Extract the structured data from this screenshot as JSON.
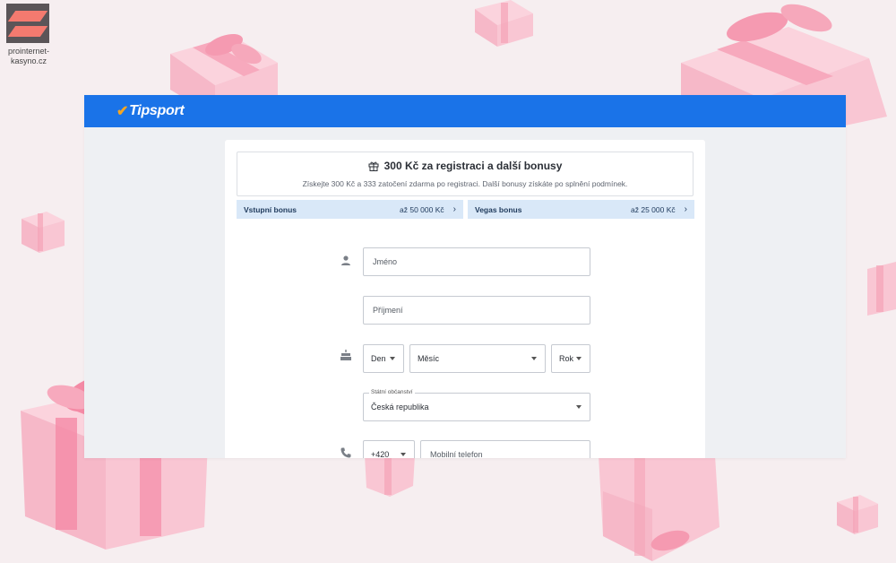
{
  "watermark": {
    "line1": "prointernet-",
    "line2": "kasyno.cz"
  },
  "header": {
    "brand": "Tipsport"
  },
  "promo": {
    "title": "300 Kč za registraci a další bonusy",
    "subtitle": "Získejte 300 Kč a 333 zatočení zdarma po registraci. Další bonusy získáte po splnění podmínek."
  },
  "bonuses": [
    {
      "label": "Vstupní bonus",
      "value": "až 50 000 Kč"
    },
    {
      "label": "Vegas bonus",
      "value": "až 25 000 Kč"
    }
  ],
  "form": {
    "first_name_placeholder": "Jméno",
    "last_name_placeholder": "Příjmení",
    "day": "Den",
    "month": "Měsíc",
    "year": "Rok",
    "citizenship_label": "Státní občanství",
    "citizenship_value": "Česká republika",
    "phone_prefix": "+420",
    "phone_placeholder": "Mobilní telefon"
  },
  "colors": {
    "header": "#1a73e8",
    "accent": "#f5a623",
    "bonus_bg": "#d9e8f8"
  },
  "icons": [
    "user-icon",
    "cake-icon",
    "phone-icon",
    "gift-icon",
    "chevron-right-icon",
    "chevron-down-icon"
  ]
}
